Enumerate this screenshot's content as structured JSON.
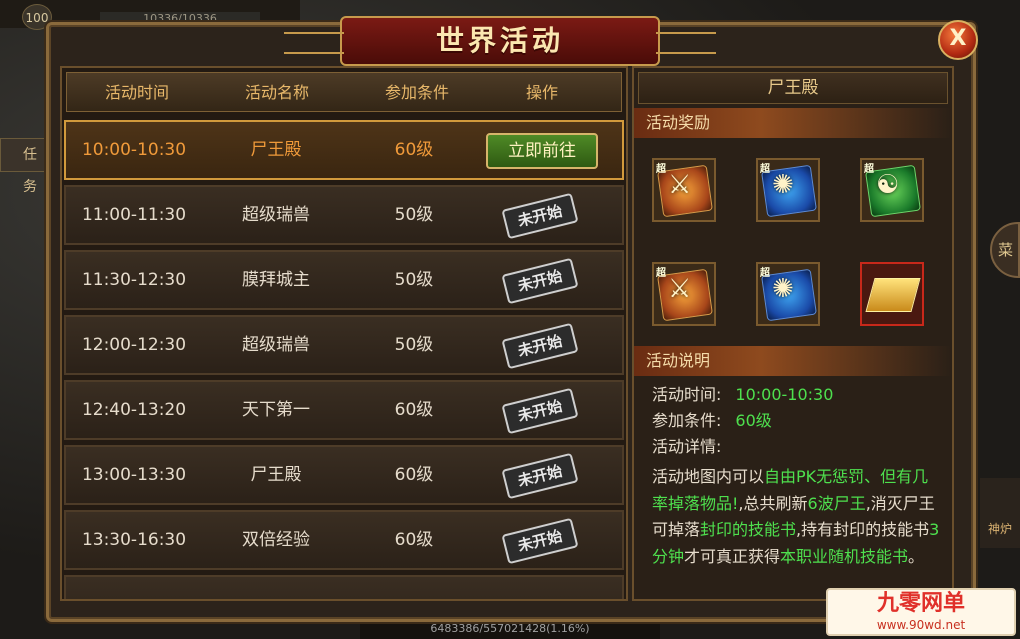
{
  "hud": {
    "level": "100",
    "hp": "10336/10336",
    "task_btn": "任务",
    "right_btn": "菜",
    "right_icon_label": "神炉",
    "exp": "6483386/557021428(1.16%)"
  },
  "window": {
    "title": "世界活动",
    "close_label": "X"
  },
  "table": {
    "headers": [
      "活动时间",
      "活动名称",
      "参加条件",
      "操作"
    ],
    "rows": [
      {
        "time": "10:00-10:30",
        "name": "尸王殿",
        "req": "60级",
        "action": "立即前往"
      },
      {
        "time": "11:00-11:30",
        "name": "超级瑞兽",
        "req": "50级",
        "action": "未开始"
      },
      {
        "time": "11:30-12:30",
        "name": "膜拜城主",
        "req": "50级",
        "action": "未开始"
      },
      {
        "time": "12:00-12:30",
        "name": "超级瑞兽",
        "req": "50级",
        "action": "未开始"
      },
      {
        "time": "12:40-13:20",
        "name": "天下第一",
        "req": "60级",
        "action": "未开始"
      },
      {
        "time": "13:00-13:30",
        "name": "尸王殿",
        "req": "60级",
        "action": "未开始"
      },
      {
        "time": "13:30-16:30",
        "name": "双倍经验",
        "req": "60级",
        "action": "未开始"
      }
    ]
  },
  "detail": {
    "title": "尸王殿",
    "rewards_header": "活动奖励",
    "desc_header": "活动说明",
    "time_label": "活动时间:",
    "time_value": "10:00-10:30",
    "req_label": "参加条件:",
    "req_value": "60级",
    "detail_label": "活动详情:",
    "desc_parts": [
      {
        "t": "活动地图内可以",
        "g": false
      },
      {
        "t": "自由PK无惩罚、但有几率掉落物品!",
        "g": true
      },
      {
        "t": ",总共刷新",
        "g": false
      },
      {
        "t": "6波尸王",
        "g": true
      },
      {
        "t": ",消灭尸王可掉落",
        "g": false
      },
      {
        "t": "封印的技能书",
        "g": true
      },
      {
        "t": ",持有封印的技能书",
        "g": false
      },
      {
        "t": "3分钟",
        "g": true
      },
      {
        "t": "才可真正获得",
        "g": false
      },
      {
        "t": "本职业随机技能书",
        "g": true
      },
      {
        "t": "。",
        "g": false
      }
    ],
    "rewards": [
      {
        "icon": "skill-book-orange-icon",
        "badge": "超"
      },
      {
        "icon": "skill-book-blue-icon",
        "badge": "超"
      },
      {
        "icon": "skill-book-green-icon",
        "badge": "超"
      },
      {
        "icon": "skill-book-orange-icon",
        "badge": "超"
      },
      {
        "icon": "skill-book-blue-icon",
        "badge": "超"
      },
      {
        "icon": "gold-bars-icon",
        "badge": ""
      }
    ]
  },
  "watermark": {
    "logo": "九零网单",
    "url": "www.90wd.net"
  },
  "colors": {
    "accent_green": "#4ee04e",
    "active_orange": "#f09a3a",
    "frame_gold": "#c79a4c"
  }
}
